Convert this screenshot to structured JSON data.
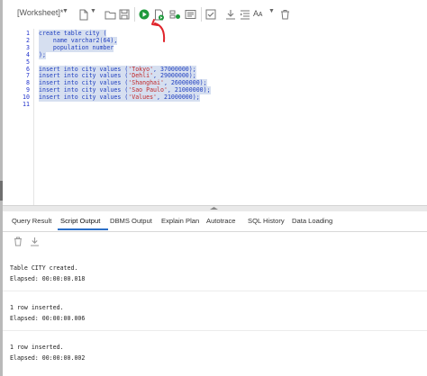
{
  "toolbar": {
    "worksheet_label": "[Worksheet]*",
    "font_label": "Aᴀ"
  },
  "editor": {
    "line_numbers": [
      "1",
      "2",
      "3",
      "4",
      "5",
      "6",
      "7",
      "8",
      "9",
      "10",
      "11"
    ],
    "lines": [
      [
        {
          "t": "create table city (",
          "c": "kw"
        }
      ],
      [
        {
          "t": "    name varchar2(64),",
          "c": "kw"
        }
      ],
      [
        {
          "t": "    population number",
          "c": "kw"
        }
      ],
      [
        {
          "t": ");",
          "c": "kw"
        }
      ],
      [],
      [
        {
          "t": "insert into city values (",
          "c": "kw"
        },
        {
          "t": "'Tokyo'",
          "c": "str"
        },
        {
          "t": ", ",
          "c": "kw"
        },
        {
          "t": "37000000",
          "c": "num"
        },
        {
          "t": ");",
          "c": "kw"
        }
      ],
      [
        {
          "t": "insert into city values (",
          "c": "kw"
        },
        {
          "t": "'Dehli'",
          "c": "str"
        },
        {
          "t": ", ",
          "c": "kw"
        },
        {
          "t": "29000000",
          "c": "num"
        },
        {
          "t": ");",
          "c": "kw"
        }
      ],
      [
        {
          "t": "insert into city values (",
          "c": "kw"
        },
        {
          "t": "'Shanghai'",
          "c": "str"
        },
        {
          "t": ", ",
          "c": "kw"
        },
        {
          "t": "26000000",
          "c": "num"
        },
        {
          "t": ");",
          "c": "kw"
        }
      ],
      [
        {
          "t": "insert into city values (",
          "c": "kw"
        },
        {
          "t": "'Sao Paulo'",
          "c": "str"
        },
        {
          "t": ", ",
          "c": "kw"
        },
        {
          "t": "21000000",
          "c": "num"
        },
        {
          "t": ");",
          "c": "kw"
        }
      ],
      [
        {
          "t": "insert into city values (",
          "c": "kw"
        },
        {
          "t": "'Values'",
          "c": "str"
        },
        {
          "t": ", ",
          "c": "kw"
        },
        {
          "t": "21000000",
          "c": "num"
        },
        {
          "t": ");",
          "c": "kw"
        }
      ],
      []
    ]
  },
  "tabs": [
    {
      "label": "Query Result",
      "active": false
    },
    {
      "label": "Script Output",
      "active": true
    },
    {
      "label": "DBMS Output",
      "active": false
    },
    {
      "label": "Explain Plan",
      "active": false
    },
    {
      "label": "Autotrace",
      "active": false
    },
    {
      "label": "SQL History",
      "active": false
    },
    {
      "label": "Data Loading",
      "active": false
    }
  ],
  "output": {
    "lines": [
      "Table CITY created.",
      "Elapsed: 00:00:00.018",
      "1 row inserted.",
      "Elapsed: 00:00:00.006",
      "1 row inserted.",
      "Elapsed: 00:00:00.002"
    ]
  },
  "colors": {
    "keyword": "#1f3fbf",
    "string": "#c0282a",
    "selection": "#d6dff0",
    "run_green": "#1e9a3c",
    "annotation_red": "#e0242b",
    "tab_accent": "#2b6fc7"
  },
  "icons": [
    "open-file-icon",
    "save-icon",
    "run-statement-icon",
    "run-script-icon",
    "explain-plan-icon",
    "autotrace-icon",
    "commit-icon",
    "rollback-icon",
    "download-icon",
    "format-icon",
    "clear-icon",
    "delete-output-icon"
  ]
}
